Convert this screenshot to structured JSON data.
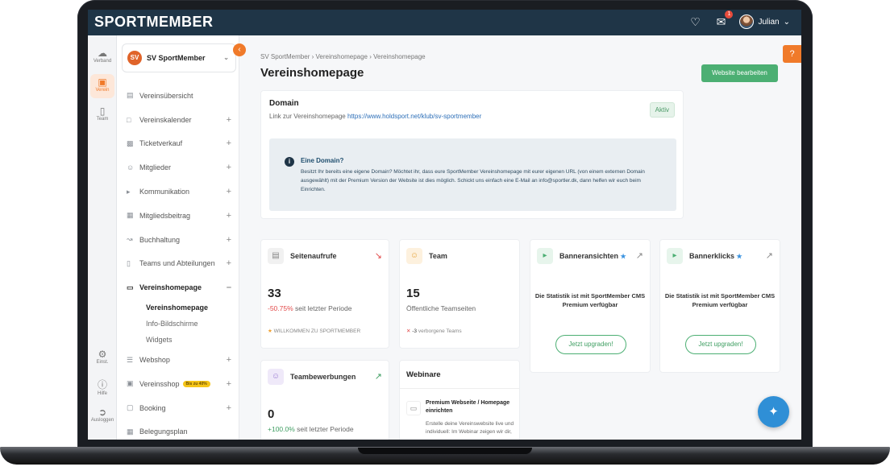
{
  "app": {
    "logo": "SPORTMEMBER"
  },
  "topbar": {
    "notification_count": "1",
    "user_name": "Julian"
  },
  "rail": [
    {
      "label": "Verband",
      "icon": "cloud-icon"
    },
    {
      "label": "Verein",
      "icon": "shop-icon",
      "active": true
    },
    {
      "label": "Team",
      "icon": "shirt-icon"
    },
    {
      "label": "Einst.",
      "icon": "gear-icon"
    },
    {
      "label": "Hilfe",
      "icon": "help-icon"
    },
    {
      "label": "Ausloggen",
      "icon": "logout-icon"
    }
  ],
  "club": {
    "logo_text": "SV",
    "name": "SV SportMember"
  },
  "nav": {
    "items": [
      {
        "label": "Vereinsübersicht"
      },
      {
        "label": "Vereinskalender"
      },
      {
        "label": "Ticketverkauf"
      },
      {
        "label": "Mitglieder"
      },
      {
        "label": "Kommunikation"
      },
      {
        "label": "Mitgliedsbeitrag"
      },
      {
        "label": "Buchhaltung"
      },
      {
        "label": "Teams und Abteilungen"
      },
      {
        "label": "Vereinshomepage"
      },
      {
        "label": "Webshop"
      },
      {
        "label": "Vereinsshop"
      },
      {
        "label": "Booking"
      },
      {
        "label": "Belegungsplan"
      }
    ],
    "sub": [
      {
        "label": "Vereinshomepage"
      },
      {
        "label": "Info-Bildschirme"
      },
      {
        "label": "Widgets"
      }
    ],
    "vereinsshop_pill": "Bis zu 40%"
  },
  "breadcrumb": {
    "a": "SV SportMember",
    "b": "Vereinshomepage",
    "c": "Vereinshomepage",
    "sep": "›"
  },
  "page": {
    "title": "Vereinshomepage",
    "edit_button": "Website bearbeiten",
    "help": "?"
  },
  "domain": {
    "title": "Domain",
    "link_prefix": "Link zur Vereinshomepage",
    "link_url": "https://www.holdsport.net/klub/sv-sportmember",
    "status": "Aktiv",
    "info_title": "Eine Domain?",
    "info_text": "Besitzt Ihr bereits eine eigene Domain? Möchtet ihr, dass eure SportMember Vereinshomepage mit eurer eigenen URL (von einem externen Domain ausgewählt) mit der Premium Version der Website ist dies möglich. Schickt uns einfach eine E-Mail an info@sportler.dk, dann helfen wir euch beim Einrichten."
  },
  "stats": {
    "seitenaufrufe": {
      "label": "Seitenaufrufe",
      "value": "33",
      "change": "-50.75%",
      "suffix": "seit letzter Periode",
      "footer": "WILLKOMMEN ZU SPORTMEMBER"
    },
    "team": {
      "label": "Team",
      "value": "15",
      "sub": "Öffentliche Teamseiten",
      "footer_count": "-3",
      "footer_text": "verborgene Teams"
    },
    "bannerans": {
      "label": "Banneransichten",
      "msg1": "Die Statistik ist mit SportMember CMS",
      "msg2": "Premium verfügbar",
      "button": "Jetzt upgraden!"
    },
    "bannerklicks": {
      "label": "Bannerklicks",
      "msg1": "Die Statistik ist mit SportMember CMS",
      "msg2": "Premium verfügbar",
      "button": "Jetzt upgraden!"
    },
    "teambew": {
      "label": "Teambewerbungen",
      "value": "0",
      "change": "+100.0%",
      "suffix": "seit letzter Periode"
    }
  },
  "webinare": {
    "title": "Webinare",
    "item_title": "Premium Webseite / Homepage einrichten",
    "item_desc": "Erstelle deine Vereinswebsite live und individuell: Im Webinar zeigen wir dir,"
  },
  "colors": {
    "topbar": "#1f3547",
    "accent": "#f07a2a",
    "primary_green": "#4caf73",
    "link": "#2d6fb8"
  }
}
